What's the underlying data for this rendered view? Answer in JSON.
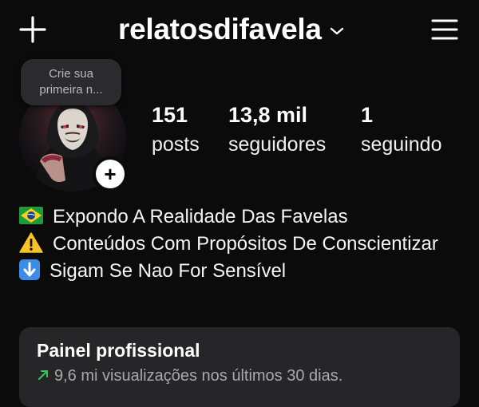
{
  "header": {
    "username": "relatosdifavela",
    "new_post_icon": "plus-icon",
    "switch_account_icon": "chevron-down-icon",
    "menu_icon": "hamburger-menu-icon"
  },
  "note": {
    "line1": "Crie sua",
    "line2": "primeira n..."
  },
  "profile": {
    "avatar_icon": "profile-avatar",
    "add_story_symbol": "+"
  },
  "stats": {
    "posts": {
      "value": "151",
      "label": "posts"
    },
    "followers": {
      "value": "13,8 mil",
      "label": "seguidores"
    },
    "following": {
      "value": "1",
      "label": "seguindo"
    }
  },
  "bio": {
    "line1": {
      "icon": "brazil-flag-icon",
      "text": "Expondo A Realidade Das Favelas"
    },
    "line2": {
      "icon": "warning-icon",
      "text": "Conteúdos Com Propósitos De Conscientizar"
    },
    "line3": {
      "icon": "down-arrow-icon",
      "text": "Sigam Se Nao For Sensível"
    }
  },
  "dashboard": {
    "title": "Painel profissional",
    "trend_icon": "trend-up-icon",
    "subtitle": "9,6 mi visualizações nos últimos 30 dias."
  },
  "colors": {
    "background": "#0b0b0c",
    "panel": "#262629",
    "trend": "#34c759"
  }
}
